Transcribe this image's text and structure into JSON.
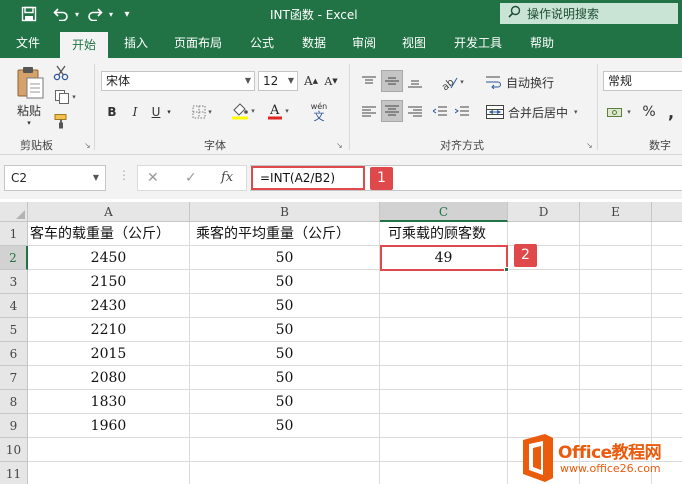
{
  "window": {
    "title": "INT函数 - Excel",
    "tell_me": "操作说明搜索"
  },
  "tabs": [
    "文件",
    "开始",
    "插入",
    "页面布局",
    "公式",
    "数据",
    "审阅",
    "视图",
    "开发工具",
    "帮助"
  ],
  "active_tab": "开始",
  "ribbon": {
    "clipboard": {
      "paste": "粘贴",
      "label": "剪贴板"
    },
    "font": {
      "name": "宋体",
      "size": "12",
      "bold": "B",
      "italic": "I",
      "underline": "U",
      "label": "字体",
      "grow": "A",
      "shrink": "A",
      "phonetic_top": "wén",
      "phonetic_bottom": "文"
    },
    "alignment": {
      "wrap": "自动换行",
      "merge": "合并后居中",
      "label": "对齐方式"
    },
    "number": {
      "format": "常规",
      "percent": "%",
      "comma": ",",
      "label": "数字"
    }
  },
  "formula_bar": {
    "name_box": "C2",
    "fx": "fx",
    "formula": "=INT(A2/B2)",
    "badge": "1"
  },
  "sheet": {
    "columns": [
      "A",
      "B",
      "C",
      "D",
      "E"
    ],
    "rows": [
      "1",
      "2",
      "3",
      "4",
      "5",
      "6",
      "7",
      "8",
      "9",
      "10",
      "11"
    ],
    "header": [
      "客车的载重量（公斤）",
      "乘客的平均重量（公斤）",
      "可乘载的顾客数"
    ],
    "data": [
      [
        "2450",
        "50",
        "49"
      ],
      [
        "2150",
        "50",
        ""
      ],
      [
        "2430",
        "50",
        ""
      ],
      [
        "2210",
        "50",
        ""
      ],
      [
        "2015",
        "50",
        ""
      ],
      [
        "2080",
        "50",
        ""
      ],
      [
        "1830",
        "50",
        ""
      ],
      [
        "1960",
        "50",
        ""
      ]
    ],
    "active_badge": "2"
  },
  "watermark": {
    "brand": "Office教程网",
    "url": "www.office26.com"
  },
  "colors": {
    "excel_green": "#217346",
    "highlight_red": "#e0494b",
    "logo_orange": "#ea5b0c"
  }
}
